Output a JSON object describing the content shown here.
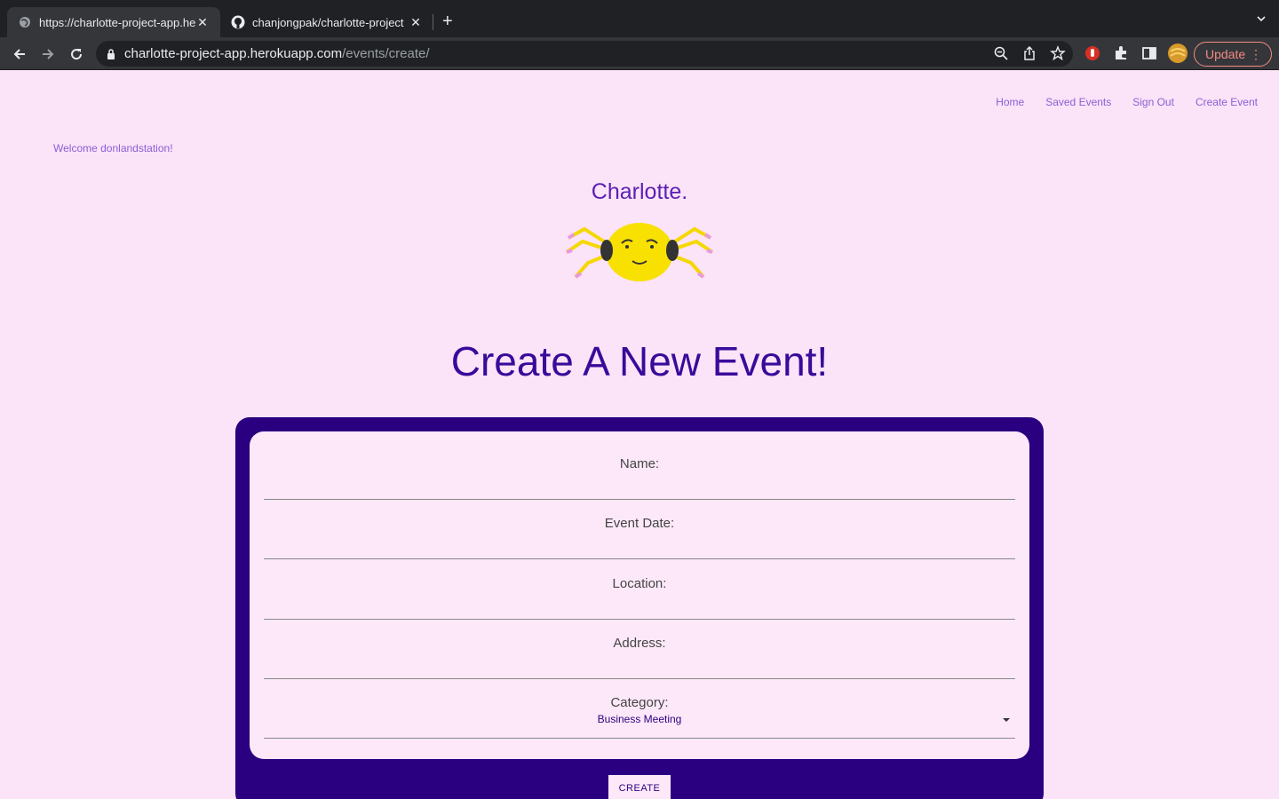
{
  "browser": {
    "tabs": [
      {
        "title": "https://charlotte-project-app.herokuapp.com",
        "active": true
      },
      {
        "title": "chanjongpak/charlotte-project",
        "active": false
      }
    ],
    "url_host": "charlotte-project-app.herokuapp.com",
    "url_path": "/events/create/",
    "update_label": "Update",
    "icons": [
      "back-icon",
      "forward-icon",
      "reload-icon",
      "lock-icon",
      "zoom-icon",
      "share-icon",
      "star-icon",
      "extension-red-icon",
      "puzzle-icon",
      "sidepanel-icon",
      "avatar",
      "more-icon"
    ]
  },
  "nav": {
    "home": "Home",
    "saved_events": "Saved Events",
    "sign_out": "Sign Out",
    "create_event": "Create Event"
  },
  "welcome": "Welcome donlandstation!",
  "brand": "Charlotte.",
  "heading": "Create A New Event!",
  "form": {
    "name_label": "Name:",
    "date_label": "Event Date:",
    "location_label": "Location:",
    "address_label": "Address:",
    "category_label": "Category:",
    "category_value": "Business Meeting",
    "submit": "CREATE"
  },
  "colors": {
    "page_bg": "#fbe3f8",
    "accent": "#2a0080",
    "link": "#8b5fd6",
    "heading": "#3a0a9a"
  }
}
